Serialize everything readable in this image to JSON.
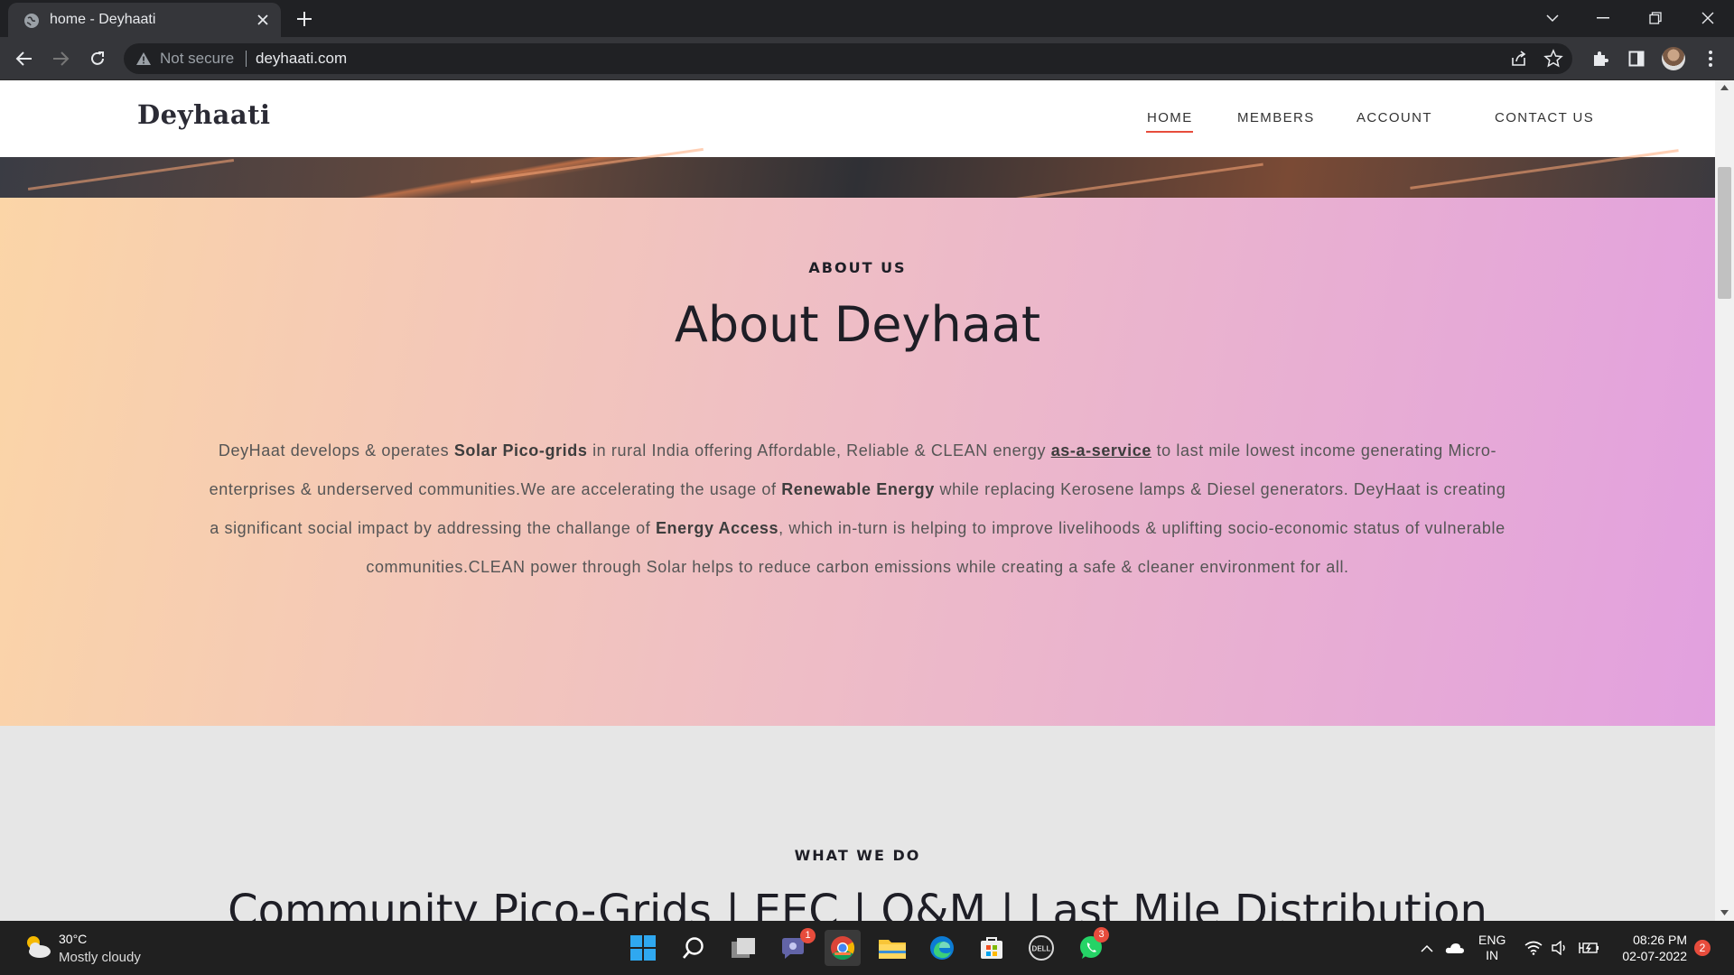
{
  "browser": {
    "tab_title": "home - Deyhaati",
    "security_label": "Not secure",
    "url": "deyhaati.com"
  },
  "site": {
    "logo": "Deyhaati",
    "nav": [
      "HOME",
      "MEMBERS",
      "ACCOUNT",
      "CONTACT US"
    ],
    "active_nav": "HOME"
  },
  "about": {
    "eyebrow": "ABOUT US",
    "title": "About Deyhaat",
    "body": {
      "p1": "DeyHaat develops & operates ",
      "b1": "Solar Pico-grids",
      "p2": "  in rural India offering Affordable, Reliable & CLEAN energy ",
      "link": "as-a-service",
      "p3": " to last mile lowest income generating Micro-enterprises & underserved communities.We are accelerating the usage of  ",
      "b2": "Renewable Energy",
      "p4": " while replacing Kerosene lamps & Diesel generators. DeyHaat is creating a significant social impact by addressing the challange of  ",
      "b3": "Energy Access",
      "p5": ", which in-turn is helping to improve livelihoods & uplifting socio-economic status of vulnerable communities.CLEAN power through Solar helps to reduce carbon emissions while creating a safe & cleaner environment for all."
    }
  },
  "what_we_do": {
    "eyebrow": "WHAT WE DO",
    "title": "Community Pico-Grids | EEC | O&M | Last Mile Distribution"
  },
  "taskbar": {
    "weather_temp": "30°C",
    "weather_desc": "Mostly cloudy",
    "teams_badge": "1",
    "whatsapp_badge": "3",
    "lang_line1": "ENG",
    "lang_line2": "IN",
    "time": "08:26 PM",
    "date": "02-07-2022",
    "notifications": "2"
  }
}
